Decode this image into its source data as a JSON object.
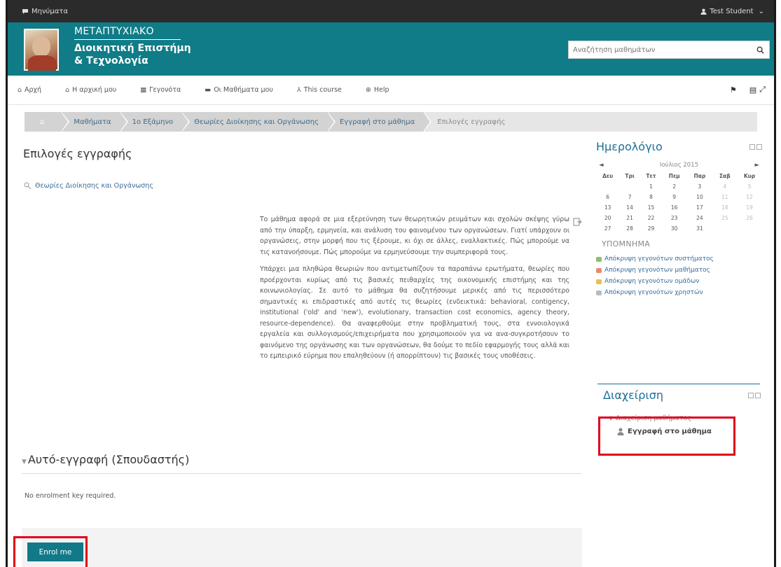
{
  "topbar": {
    "messages_label": "Μηνύματα",
    "user_label": "Test Student"
  },
  "header": {
    "line1": "ΜΕΤΑΠΤΥΧΙΑΚΟ",
    "line2": "Διοικητική Επιστήμη",
    "line3": "& Τεχνολογία",
    "search_placeholder": "Αναζήτηση μαθημάτων"
  },
  "nav": {
    "home": "Αρχή",
    "dashboard": "Η αρχική μου",
    "events": "Γεγονότα",
    "courses": "Οι Μαθήματα μου",
    "this_course": "This course",
    "help": "Help"
  },
  "breadcrumb": [
    "Μαθήματα",
    "1ο Εξάμηνο",
    "Θεωρίες Διοίκησης και Οργάνωσης",
    "Εγγραφή στο μάθημα",
    "Επιλογές εγγραφής"
  ],
  "main": {
    "title": "Επιλογές εγγραφής",
    "course_link": "Θεωρίες Διοίκησης και Οργάνωσης",
    "summary_p1": "Το μάθημα αφορά σε μια εξερεύνηση των θεωρητικών ρευμάτων και σχολών σκέψης γύρω από την ύπαρξη, ερμηνεία, και ανάλυση του φαινομένου των οργανώσεων. Γιατί υπάρχουν οι οργανώσεις, στην μορφή που τις ξέρουμε, κι όχι σε άλλες, εναλλακτικές. Πώς μπορούμε να τις κατανοήσουμε. Πώς μπορούμε να ερμηνεύσουμε την συμπεριφορά τους.",
    "summary_p2": "Υπάρχει μια πληθώρα θεωριών που αντιμετωπίζουν τα παραπάνω ερωτήματα, θεωρίες που προέρχονται κυρίως από τις βασικές πειθαρχίες της οικονομικής επιστήμης και της κοινωνιολογίας. Σε αυτό το μάθημα θα συζητήσουμε μερικές από τις περισσότερο σημαντικές κι επιδραστικές από αυτές τις θεωρίες (ενδεικτικά: behavioral, contigency, institutional ('old' and 'new'), evolutionary, transaction cost economics, agency theory, resource-dependence). Θα αναφερθούμε στην προβληματική τους, στα εννοιολογικά εργαλεία και συλλογισμούς/επιχειρήματα που χρησιμοποιούν για να ανα-συγκροτήσουν το φαινόμενο της οργάνωσης και των οργανώσεων, θα δούμε το πεδίο εφαρμογής τους αλλά και το εμπειρικό εύρημα που επαληθεύουν (ή απορρίπτουν) τις βασικές τους υποθέσεις.",
    "self_enrol_heading": "Αυτό-εγγραφή (Σπουδαστής)",
    "no_key": "No enrolment key required.",
    "enrol_button": "Enrol me"
  },
  "calendar": {
    "title": "Ημερολόγιο",
    "prev": "◄",
    "next": "►",
    "month": "Ιούλιος 2015",
    "days": [
      "Δευ",
      "Τρι",
      "Τετ",
      "Πεμ",
      "Παρ",
      "Σαβ",
      "Κυρ"
    ],
    "weeks": [
      [
        "",
        "",
        "1",
        "2",
        "3",
        "4",
        "5"
      ],
      [
        "6",
        "7",
        "8",
        "9",
        "10",
        "11",
        "12"
      ],
      [
        "13",
        "14",
        "15",
        "16",
        "17",
        "18",
        "19"
      ],
      [
        "20",
        "21",
        "22",
        "23",
        "24",
        "25",
        "26"
      ],
      [
        "27",
        "28",
        "29",
        "30",
        "31",
        "",
        ""
      ]
    ],
    "legend_title": "ΥΠΟΜΝΗΜΑ",
    "legend": [
      {
        "label": "Απόκρυψη γεγονότων συστήματος",
        "color": "#8cbf6a"
      },
      {
        "label": "Απόκρυψη γεγονότων μαθήματος",
        "color": "#e98a6a"
      },
      {
        "label": "Απόκρυψη γεγονότων ομάδων",
        "color": "#e8c050"
      },
      {
        "label": "Απόκρυψη γεγονότων χρηστών",
        "color": "#b5bcc8"
      }
    ]
  },
  "admin": {
    "title": "Διαχείριση",
    "course_admin": "Διαχείριση μαθήματος",
    "enrol_item": "Εγγραφή στο μάθημα"
  }
}
